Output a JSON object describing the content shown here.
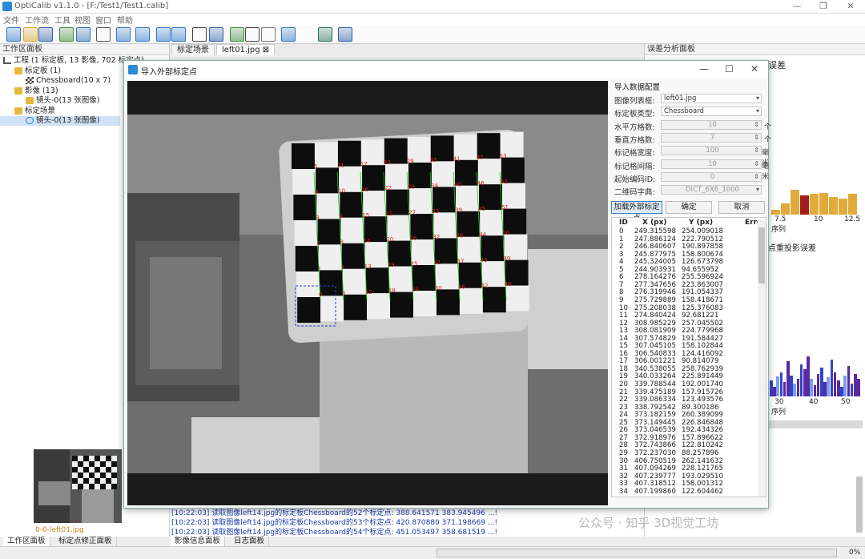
{
  "window": {
    "title": "OptiCalib v1.1.0 - [F:/Test1/Test1.calib]"
  },
  "menu": [
    "文件",
    "工作流",
    "工具",
    "视图",
    "窗口",
    "帮助"
  ],
  "toolbar_icons": [
    "new-file-icon",
    "open-folder-icon",
    "save-icon",
    "chessboard-icon",
    "image-import-icon",
    "settings-icon",
    "play-icon",
    "refresh-icon",
    "camera-zoom-icon",
    "camera-search-icon",
    "crosshair-icon",
    "stereo-icon",
    "chart-line-icon",
    "board-icon",
    "checker-icon",
    "camera-icon",
    "layers-icon",
    "user-settings-icon"
  ],
  "left_panel": {
    "title": "工作区面板",
    "tree": [
      {
        "label": "工程 (1 标定板, 13 影像, 702 标定点)",
        "level": 0,
        "icon": "project-icon"
      },
      {
        "label": "标定板 (1)",
        "level": 1,
        "icon": "folder-icon"
      },
      {
        "label": "Chessboard(10 x 7)",
        "level": 2,
        "icon": "chessboard-icon"
      },
      {
        "label": "影像 (13)",
        "level": 1,
        "icon": "folder-icon"
      },
      {
        "label": "镜头-0(13 张图像)",
        "level": 2,
        "icon": "folder-icon"
      },
      {
        "label": "标定场景",
        "level": 1,
        "icon": "folder-icon"
      },
      {
        "label": "镜头-0(13 张图像)",
        "level": 2,
        "icon": "eye-icon",
        "selected": true
      }
    ]
  },
  "center_tabs": [
    {
      "label": "标定场景"
    },
    {
      "label": "left01.jpg"
    }
  ],
  "right_panel": {
    "title": "误差分析面板",
    "chart1_title": "误差",
    "chart1_ticks": [
      "7.5",
      "10",
      "12.5"
    ],
    "chart1_xlabel": "序列",
    "chart2_title": "点重投影误差",
    "chart2_ticks": [
      "30",
      "40",
      "50"
    ],
    "chart2_xlabel": "序列"
  },
  "thumbnail": {
    "caption": "0-0-left01.jpg"
  },
  "log": [
    "[10:22:03] 读取图像left14.jpg的标定板Chessboard的52个标定点: 388.641571 383.945496 ...!",
    "[10:22:03] 读取图像left14.jpg的标定板Chessboard的53个标定点: 420.870880 371.198669 ...!",
    "[10:22:03] 读取图像left14.jpg的标定板Chessboard的54个标定点: 451.053497 358.681519 ...!"
  ],
  "bottom_tabs": [
    "工作区面板",
    "标定点修正面板",
    "影像信息面板",
    "日志面板"
  ],
  "status": {
    "progress": "0%"
  },
  "watermark": "公众号 · 知乎 3D视觉工坊",
  "dialog": {
    "title": "导入外部标定点",
    "section": "导入数据配置",
    "fields": [
      {
        "label": "图像列表框:",
        "value": "left01.jpg",
        "type": "select"
      },
      {
        "label": "标定板类型:",
        "value": "Chessboard",
        "type": "select"
      },
      {
        "label": "水平方格数:",
        "value": "10",
        "unit": "个",
        "type": "spin"
      },
      {
        "label": "垂直方格数:",
        "value": "7",
        "unit": "个",
        "type": "spin"
      },
      {
        "label": "标记格宽度:",
        "value": "100",
        "unit": "毫米",
        "type": "spin"
      },
      {
        "label": "标记格间隔:",
        "value": "10",
        "unit": "毫米",
        "type": "spin"
      },
      {
        "label": "起始编码ID:",
        "value": "0",
        "type": "spin"
      },
      {
        "label": "二维码字典:",
        "value": "DICT_6X6_1000",
        "type": "select"
      }
    ],
    "buttons": {
      "load": "加载外部标定点",
      "ok": "确定",
      "cancel": "取消"
    },
    "table": {
      "headers": [
        "ID",
        "X (px)",
        "Y (px)",
        "Erro"
      ],
      "rows": [
        [
          "0",
          "249.315598",
          "254.009018"
        ],
        [
          "1",
          "247.886124",
          "222.790512"
        ],
        [
          "2",
          "246.840607",
          "190.897858"
        ],
        [
          "3",
          "245.877975",
          "158.800674"
        ],
        [
          "4",
          "245.324005",
          "126.673798"
        ],
        [
          "5",
          "244.903931",
          "94.655952"
        ],
        [
          "6",
          "278.164276",
          "255.596924"
        ],
        [
          "7",
          "277.347656",
          "223.863007"
        ],
        [
          "8",
          "276.319946",
          "191.054337"
        ],
        [
          "9",
          "275.729889",
          "158.418671"
        ],
        [
          "10",
          "275.208038",
          "125.376083"
        ],
        [
          "11",
          "274.840424",
          "92.681221"
        ],
        [
          "12",
          "308.985229",
          "257.045502"
        ],
        [
          "13",
          "308.081909",
          "224.779968"
        ],
        [
          "14",
          "307.574829",
          "191.584427"
        ],
        [
          "15",
          "307.045105",
          "158.102844"
        ],
        [
          "16",
          "306.540833",
          "124.416092"
        ],
        [
          "17",
          "306.001221",
          "90.814079"
        ],
        [
          "18",
          "340.538055",
          "258.762939"
        ],
        [
          "19",
          "340.033264",
          "225.891449"
        ],
        [
          "20",
          "339.788544",
          "192.001740"
        ],
        [
          "21",
          "339.475189",
          "157.915726"
        ],
        [
          "22",
          "339.086334",
          "123.493576"
        ],
        [
          "23",
          "338.792542",
          "89.300186"
        ],
        [
          "24",
          "373.182159",
          "260.389099"
        ],
        [
          "25",
          "373.149445",
          "226.846848"
        ],
        [
          "26",
          "373.046539",
          "192.434326"
        ],
        [
          "27",
          "372.918976",
          "157.896622"
        ],
        [
          "28",
          "372.743866",
          "122.810242"
        ],
        [
          "29",
          "372.237030",
          "88.257896"
        ],
        [
          "30",
          "406.750519",
          "262.141632"
        ],
        [
          "31",
          "407.094269",
          "228.121765"
        ],
        [
          "32",
          "407.239777",
          "193.029510"
        ],
        [
          "33",
          "407.318512",
          "158.001312"
        ],
        [
          "34",
          "407.199860",
          "122.604462"
        ]
      ]
    },
    "image_labels": [
      "0",
      "1",
      "2",
      "3",
      "4",
      "5",
      "6",
      "7",
      "8",
      "9",
      "10",
      "11",
      "12",
      "13",
      "14",
      "15",
      "16",
      "17",
      "18",
      "19",
      "20",
      "21",
      "22",
      "23",
      "24",
      "25",
      "26",
      "27",
      "28",
      "29",
      "30",
      "31",
      "32",
      "33",
      "34",
      "35",
      "36",
      "37",
      "38",
      "39",
      "40",
      "41",
      "42",
      "43",
      "44",
      "45",
      "46",
      "47",
      "48",
      "49",
      "50",
      "51",
      "52",
      "53"
    ]
  }
}
